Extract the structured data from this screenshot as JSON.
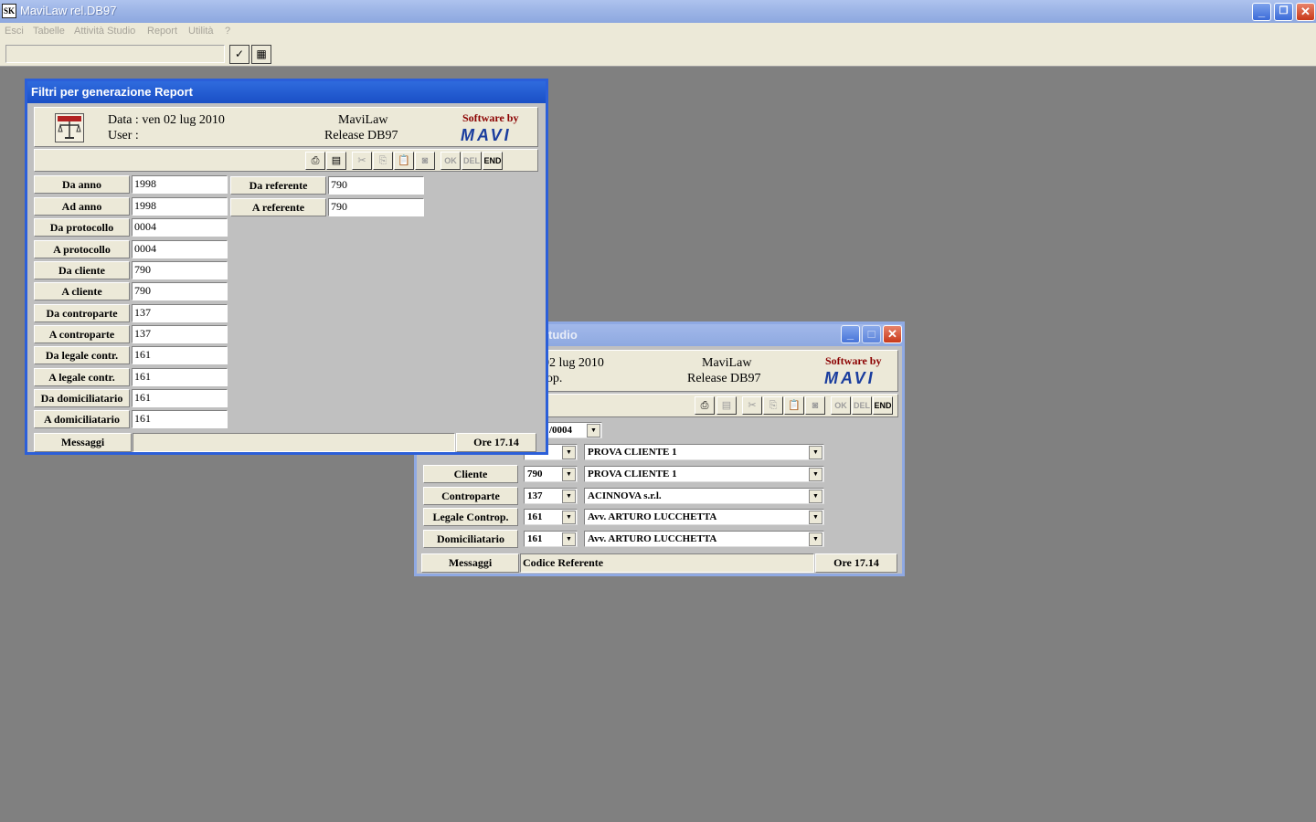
{
  "app": {
    "title": "MaviLaw rel.DB97",
    "icon_text": "ЅK"
  },
  "menu": [
    "Esci",
    "Tabelle",
    "Attività Studio",
    "Report",
    "Utilità",
    "?"
  ],
  "filter_window": {
    "title": "Filtri per generazione Report",
    "data_line": "Data : ven 02 lug 2010",
    "user_line": "User :",
    "product": "MaviLaw",
    "release": "Release DB97",
    "software_by": "Software by",
    "brand": "MAVI",
    "toolbar_text_buttons": [
      "OK",
      "DEL",
      "END"
    ],
    "fields_left": [
      {
        "label": "Da anno",
        "value": "1998"
      },
      {
        "label": "Ad anno",
        "value": "1998"
      },
      {
        "label": "Da protocollo",
        "value": "0004"
      },
      {
        "label": "A  protocollo",
        "value": "0004"
      },
      {
        "label": "Da cliente",
        "value": "790"
      },
      {
        "label": "A  cliente",
        "value": "790"
      },
      {
        "label": "Da controparte",
        "value": "137"
      },
      {
        "label": "A  controparte",
        "value": "137"
      },
      {
        "label": "Da legale contr.",
        "value": "161"
      },
      {
        "label": "A  legale contr.",
        "value": "161"
      },
      {
        "label": "Da domiciliatario",
        "value": "161"
      },
      {
        "label": "A  domiciliatario",
        "value": "161"
      }
    ],
    "fields_right": [
      {
        "label": "Da referente",
        "value": "790"
      },
      {
        "label": "A  referente",
        "value": "790"
      }
    ],
    "status": {
      "label": "Messaggi",
      "message": "",
      "time": "Ore 17.14"
    }
  },
  "back_window": {
    "title_visible": "tudio",
    "data_line": "02 lug 2010",
    "user_line": "lop.",
    "product": "MaviLaw",
    "release": "Release DB97",
    "software_by": "Software by",
    "brand": "MAVI",
    "toolbar_text_buttons": [
      "OK",
      "DEL",
      "END"
    ],
    "protocol_value": "/0004",
    "rows": [
      {
        "label": "",
        "code": "",
        "name": "PROVA CLIENTE 1"
      },
      {
        "label": "Cliente",
        "code": "790",
        "name": "PROVA CLIENTE 1"
      },
      {
        "label": "Controparte",
        "code": "137",
        "name": "ACINNOVA s.r.l."
      },
      {
        "label": "Legale Controp.",
        "code": "161",
        "name": "Avv. ARTURO LUCCHETTA"
      },
      {
        "label": "Domiciliatario",
        "code": "161",
        "name": "Avv. ARTURO LUCCHETTA"
      }
    ],
    "status": {
      "label": "Messaggi",
      "message": "Codice Referente",
      "time": "Ore 17.14"
    }
  }
}
